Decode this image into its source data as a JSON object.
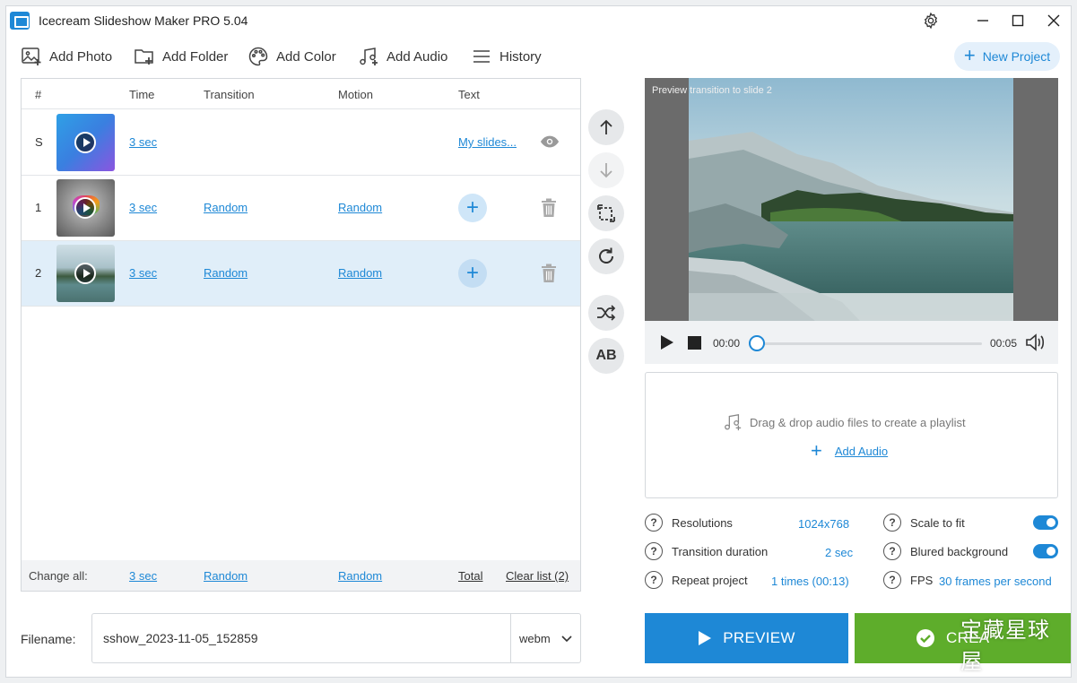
{
  "app": {
    "title": "Icecream Slideshow Maker PRO 5.04"
  },
  "toolbar": {
    "add_photo": "Add Photo",
    "add_folder": "Add Folder",
    "add_color": "Add Color",
    "add_audio": "Add Audio",
    "history": "History",
    "new_project": "New Project"
  },
  "table": {
    "headers": {
      "num": "#",
      "time": "Time",
      "transition": "Transition",
      "motion": "Motion",
      "text": "Text"
    },
    "rows": [
      {
        "num": "S",
        "time": "3 sec",
        "transition": "",
        "motion": "",
        "text": "My slides..."
      },
      {
        "num": "1",
        "time": "3 sec",
        "transition": "Random",
        "motion": "Random",
        "text": ""
      },
      {
        "num": "2",
        "time": "3 sec",
        "transition": "Random",
        "motion": "Random",
        "text": ""
      }
    ],
    "footer": {
      "change_all": "Change all:",
      "time": "3 sec",
      "transition": "Random",
      "motion": "Random",
      "total": "Total",
      "clear": "Clear list (2)"
    }
  },
  "side_buttons": {
    "swap_label": "AB"
  },
  "filename": {
    "label": "Filename:",
    "value": "sshow_2023-11-05_152859",
    "format": "webm"
  },
  "preview": {
    "caption": "Preview transition to slide 2",
    "time_current": "00:00",
    "time_total": "00:05",
    "progress": 0
  },
  "audio": {
    "drop_text": "Drag & drop audio files to create a playlist",
    "add_label": "Add Audio"
  },
  "settings": {
    "resolution": {
      "label": "Resolutions",
      "value": "1024x768"
    },
    "transition_duration": {
      "label": "Transition duration",
      "value": "2 sec"
    },
    "repeat": {
      "label": "Repeat project",
      "value": "1 times (00:13)"
    },
    "scale": {
      "label": "Scale to fit",
      "on": true
    },
    "blurred": {
      "label": "Blured background",
      "on": true
    },
    "fps": {
      "label": "FPS",
      "value": "30 frames per second"
    }
  },
  "buttons": {
    "preview": "PREVIEW",
    "create": "CREA"
  },
  "watermark": "宝藏星球屋",
  "colors": {
    "accent": "#1e88d6",
    "create": "#5ead2b",
    "selected_row": "#e0eef9"
  }
}
